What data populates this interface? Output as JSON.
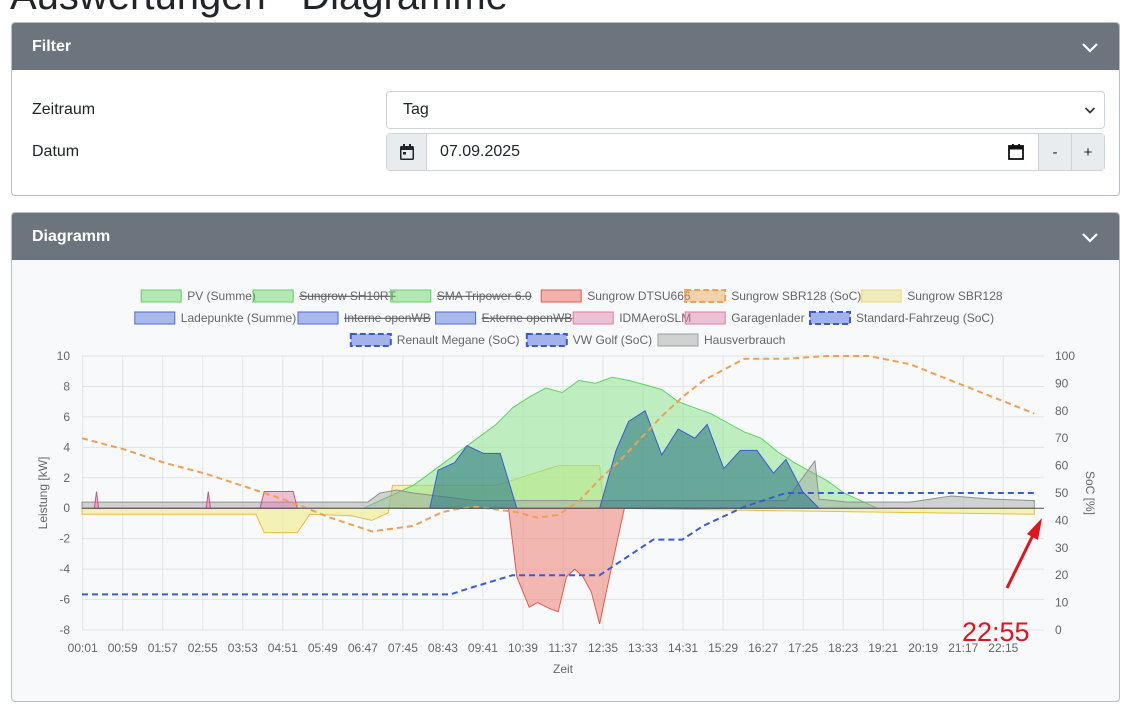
{
  "page": {
    "title": "Auswertungen - Diagramme"
  },
  "filter": {
    "header": "Filter",
    "zeitraum_label": "Zeitraum",
    "zeitraum_value": "Tag",
    "datum_label": "Datum",
    "datum_value": "07.09.2025",
    "minus_label": "-",
    "plus_label": "+"
  },
  "diagram": {
    "header": "Diagramm"
  },
  "annotation": {
    "time_label": "22:55",
    "color": "#e0141e"
  },
  "chart_data": {
    "type": "area",
    "xlabel": "Zeit",
    "ylabel": "Leistung [kW]",
    "ylabel2": "SoC [%]",
    "ylim": [
      -8,
      10
    ],
    "ylim2": [
      0,
      100
    ],
    "yticks": [
      "10",
      "8",
      "6",
      "4",
      "2",
      "0",
      "-2",
      "-4",
      "-6",
      "-8"
    ],
    "yticks2": [
      "100",
      "90",
      "80",
      "70",
      "60",
      "50",
      "40",
      "30",
      "20",
      "10",
      "0"
    ],
    "xticks": [
      "00:01",
      "00:59",
      "01:57",
      "02:55",
      "03:53",
      "04:51",
      "05:49",
      "06:47",
      "07:45",
      "08:43",
      "09:41",
      "10:39",
      "11:37",
      "12:35",
      "13:33",
      "14:31",
      "15:29",
      "16:27",
      "17:25",
      "18:23",
      "19:21",
      "20:19",
      "21:17",
      "22:15"
    ],
    "legend_placement": "top",
    "legend": [
      {
        "name": "PV (Summe)",
        "color": "#5fd35f",
        "dashed": false,
        "hidden": false
      },
      {
        "name": "Sungrow SH10RT",
        "color": "#5fd35f",
        "dashed": false,
        "hidden": true
      },
      {
        "name": "SMA Tripower 6.0",
        "color": "#5fd35f",
        "dashed": false,
        "hidden": true
      },
      {
        "name": "Sungrow DTSU666",
        "color": "#e8584a",
        "dashed": false,
        "hidden": false
      },
      {
        "name": "Sungrow SBR128 (SoC)",
        "color": "#f0a050",
        "dashed": true,
        "hidden": false
      },
      {
        "name": "Sungrow SBR128",
        "color": "#e8d870",
        "dashed": false,
        "hidden": false
      },
      {
        "name": "Ladepunkte (Summe)",
        "color": "#4a6bd8",
        "dashed": false,
        "hidden": false
      },
      {
        "name": "Interne openWB",
        "color": "#4a6bd8",
        "dashed": false,
        "hidden": true
      },
      {
        "name": "Externe openWB",
        "color": "#4a6bd8",
        "dashed": false,
        "hidden": true
      },
      {
        "name": "IDMAeroSLM",
        "color": "#e07aa8",
        "dashed": false,
        "hidden": false
      },
      {
        "name": "Garagenlader",
        "color": "#e07aa8",
        "dashed": false,
        "hidden": false
      },
      {
        "name": "Standard-Fahrzeug (SoC)",
        "color": "#3a5bd8",
        "dashed": true,
        "hidden": false
      },
      {
        "name": "Renault Megane (SoC)",
        "color": "#3a5bd8",
        "dashed": true,
        "hidden": false
      },
      {
        "name": "VW Golf (SoC)",
        "color": "#3a5bd8",
        "dashed": true,
        "hidden": false
      },
      {
        "name": "Hausverbrauch",
        "color": "#a0a0a0",
        "dashed": false,
        "hidden": false
      }
    ],
    "series": [
      {
        "name": "PV (Summe)",
        "axis": "left",
        "color": "#5fd35f",
        "x": [
          6.8,
          7.2,
          7.6,
          8.0,
          8.5,
          9.0,
          9.5,
          10.0,
          10.4,
          10.8,
          11.2,
          11.6,
          12.0,
          12.4,
          12.8,
          13.2,
          13.6,
          14.0,
          14.4,
          14.8,
          15.2,
          15.6,
          16.0,
          16.4,
          16.8,
          17.2,
          17.6,
          18.0,
          18.4,
          18.8,
          19.2
        ],
        "y": [
          0,
          0.5,
          1,
          1.5,
          2.5,
          3.5,
          4.5,
          5.5,
          6.6,
          7.3,
          7.9,
          7.6,
          8.4,
          8.2,
          8.6,
          8.4,
          8.1,
          7.8,
          7.0,
          6.6,
          6.2,
          5.6,
          5.0,
          4.6,
          3.7,
          3.0,
          2.4,
          1.8,
          1.0,
          0.5,
          0
        ]
      },
      {
        "name": "Sungrow DTSU666",
        "axis": "left",
        "color": "#e8584a",
        "x": [
          10.3,
          10.5,
          10.8,
          11.0,
          11.3,
          11.5,
          11.7,
          11.9,
          12.1,
          12.3,
          12.5,
          12.7,
          12.9,
          13.1
        ],
        "y": [
          0,
          -4.5,
          -6.5,
          -6.2,
          -6.6,
          -6.8,
          -4.5,
          -4.0,
          -4.5,
          -5.5,
          -7.6,
          -5.0,
          -2.5,
          0
        ]
      },
      {
        "name": "Sungrow SBR128 (SoC)",
        "axis": "right",
        "x": [
          0,
          1,
          2,
          3,
          4,
          5,
          6,
          7,
          8,
          8.7,
          9,
          9.5,
          10,
          10.5,
          11,
          11.5,
          12,
          12.5,
          13,
          13.5,
          14,
          14.5,
          15,
          15.5,
          16,
          17,
          18,
          19,
          20,
          21,
          22,
          23
        ],
        "y": [
          70,
          66,
          61,
          57,
          52,
          47,
          41,
          36,
          38,
          43,
          44,
          45,
          44,
          43,
          41,
          42,
          47,
          55,
          62,
          70,
          78,
          85,
          91,
          95,
          99,
          99,
          100,
          100,
          97,
          91,
          85,
          79
        ]
      },
      {
        "name": "Standard-Fahrzeug (SoC)",
        "axis": "right",
        "x": [
          0,
          8.9,
          9.3,
          10.4,
          11,
          12.5,
          13,
          13.8,
          14.5,
          15,
          16,
          17,
          18,
          19,
          23
        ],
        "y": [
          13,
          13,
          15,
          20,
          20,
          20,
          25,
          33,
          33,
          38,
          45,
          50,
          50,
          50,
          50
        ]
      },
      {
        "name": "Sungrow SBR128",
        "axis": "left",
        "x": [
          0,
          4.2,
          4.4,
          5.2,
          5.5,
          6.5,
          7,
          7.4,
          7.5,
          10,
          11.5,
          12.5,
          12.6,
          23
        ],
        "y": [
          -0.4,
          -0.4,
          -1.6,
          -1.6,
          -0.4,
          -0.5,
          -0.8,
          -0.3,
          1.5,
          1.5,
          2.8,
          2.8,
          0,
          -0.4
        ]
      },
      {
        "name": "Hausverbrauch",
        "axis": "left",
        "x": [
          0,
          6.9,
          7.2,
          7.6,
          8.0,
          8.6,
          9.5,
          10.5,
          12,
          13,
          14,
          15,
          16,
          17,
          17.7,
          17.8,
          18.5,
          19,
          20,
          21,
          22,
          23
        ],
        "y": [
          0.4,
          0.4,
          1.0,
          1.2,
          1.0,
          0.8,
          0.5,
          0.5,
          0.5,
          0.5,
          0.5,
          0.5,
          0.5,
          0.5,
          3.1,
          0.6,
          0.4,
          0.4,
          0.4,
          0.8,
          0.6,
          0.5
        ]
      },
      {
        "name": "Ladepunkte (Summe)",
        "axis": "left",
        "x": [
          8.4,
          8.6,
          9.0,
          9.3,
          9.7,
          10.1,
          10.5,
          12.5,
          12.9,
          13.2,
          13.6,
          14.0,
          14.4,
          14.8,
          15.1,
          15.5,
          15.9,
          16.3,
          16.7,
          17.0,
          17.4,
          17.8
        ],
        "y": [
          0,
          2.5,
          3.0,
          4.1,
          3.6,
          3.6,
          0,
          0,
          3.8,
          5.7,
          6.4,
          3.5,
          5.2,
          4.6,
          5.5,
          2.6,
          3.8,
          3.8,
          2.3,
          3.2,
          1.1,
          0
        ]
      },
      {
        "name": "IDMAeroSLM",
        "axis": "left",
        "x": [
          0.3,
          0.35,
          0.4,
          3.0,
          3.05,
          3.1,
          4.3,
          4.4,
          5.1,
          5.2
        ],
        "y": [
          0,
          1.1,
          0,
          0,
          1.1,
          0,
          0,
          1.1,
          1.1,
          0
        ]
      }
    ]
  }
}
